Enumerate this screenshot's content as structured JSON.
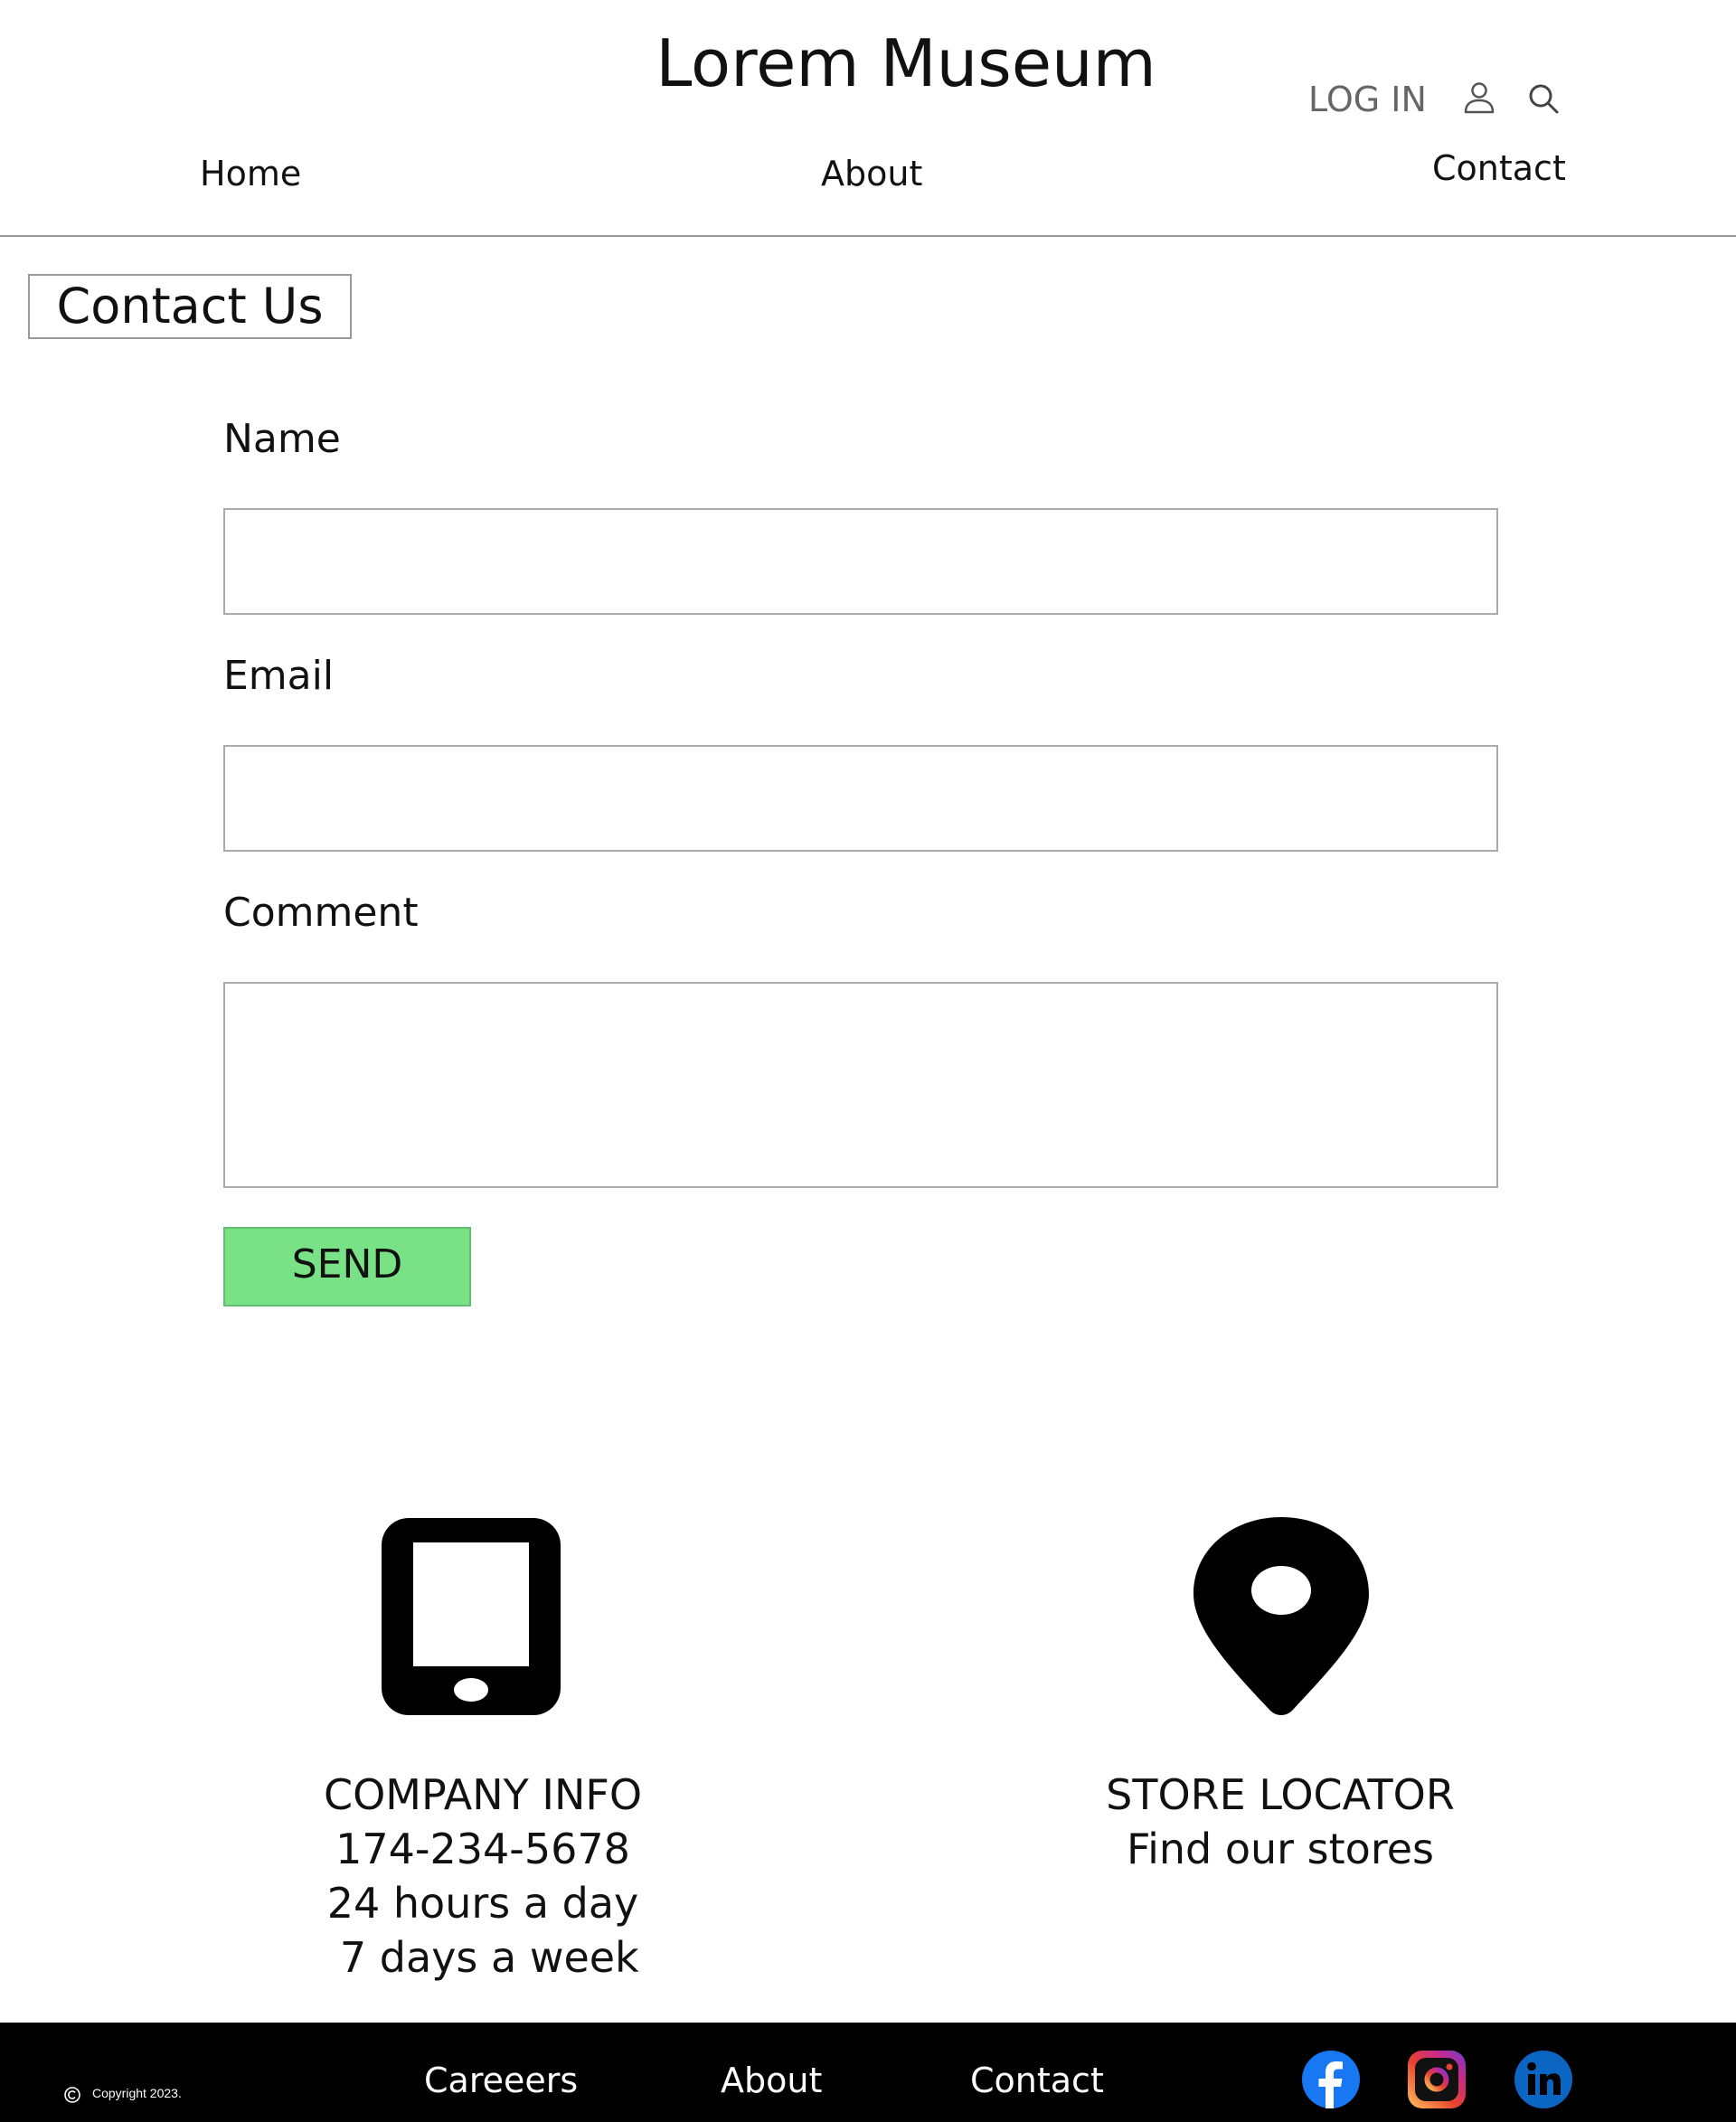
{
  "header": {
    "site_title": "Lorem Museum",
    "login_label": "LOG IN",
    "icons": [
      "user-icon",
      "search-icon"
    ],
    "nav": [
      {
        "label": "Home"
      },
      {
        "label": "About"
      },
      {
        "label": "Contact"
      }
    ]
  },
  "contact_form": {
    "heading": "Contact Us",
    "name_label": "Name",
    "name_value": "",
    "email_label": "Email",
    "email_value": "",
    "comment_label": "Comment",
    "comment_value": "",
    "send_label": "SEND",
    "send_color": "#79e186"
  },
  "info": {
    "company": {
      "icon": "phone-icon",
      "title": "COMPANY INFO",
      "phone": "174-234-5678",
      "hours": "24 hours a day",
      "days": " 7 days a week"
    },
    "store": {
      "icon": "map-pin-icon",
      "title": "STORE LOCATOR",
      "subtitle": "Find our stores"
    }
  },
  "footer": {
    "copyright": "Copyright 2023.",
    "links": [
      {
        "label": "Careeers"
      },
      {
        "label": "About"
      },
      {
        "label": "Contact"
      }
    ],
    "social": [
      "facebook-icon",
      "instagram-icon",
      "linkedin-icon"
    ],
    "colors": {
      "background": "#000000",
      "facebook": "#1877f2",
      "linkedin": "#0a66c2"
    }
  }
}
